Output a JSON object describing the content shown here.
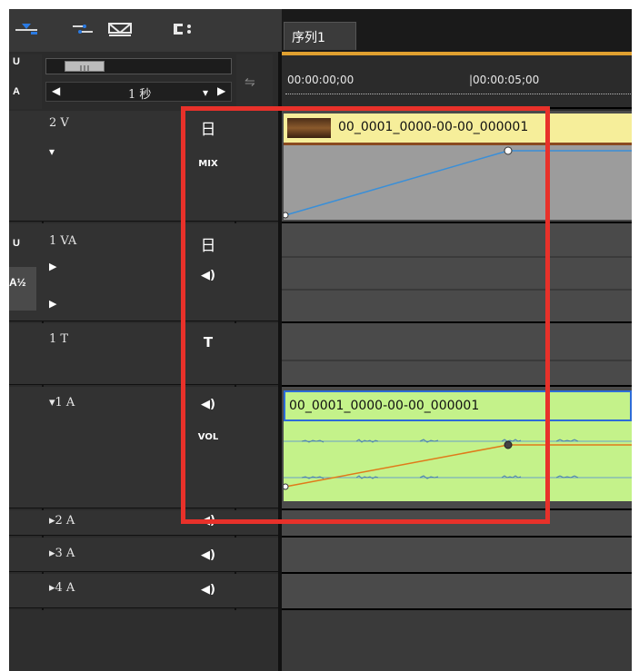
{
  "sequence_tab": "序列1",
  "timeline": {
    "zoom_label": "1 秒",
    "timecode_0": "00:00:00;00",
    "timecode_5": "|00:00:05;00"
  },
  "left_header": {
    "v_label": "U",
    "a_label": "A"
  },
  "tracks": {
    "v2": {
      "name": "2 V",
      "icon1": "日",
      "icon2": "MIX"
    },
    "va1": {
      "name": "1 VA",
      "icon1": "日",
      "icon2": "◀)"
    },
    "t1": {
      "name": "1 T",
      "icon1": "T"
    },
    "a1": {
      "name": "▾1 A",
      "icon1": "◀)",
      "icon2": "VOL"
    },
    "a2": {
      "name": "▸2 A",
      "icon1": "◀)"
    },
    "a3": {
      "name": "▸3 A",
      "icon1": "◀)"
    },
    "a4": {
      "name": "▸4 A",
      "icon1": "◀)"
    }
  },
  "side_labels": {
    "va1_side_top": "U",
    "va1_side_bottom": "A½"
  },
  "clips": {
    "video_clip": "00_0001_0000-00-00_000001",
    "audio_clip": "00_0001_0000-00-00_000001"
  },
  "colors": {
    "highlight_box": "#e8312a",
    "video_clip_header": "#f6ee9a",
    "audio_clip": "#c4f28a",
    "rubber_band_video": "#3a8fd8",
    "rubber_band_audio": "#e07a1a"
  }
}
